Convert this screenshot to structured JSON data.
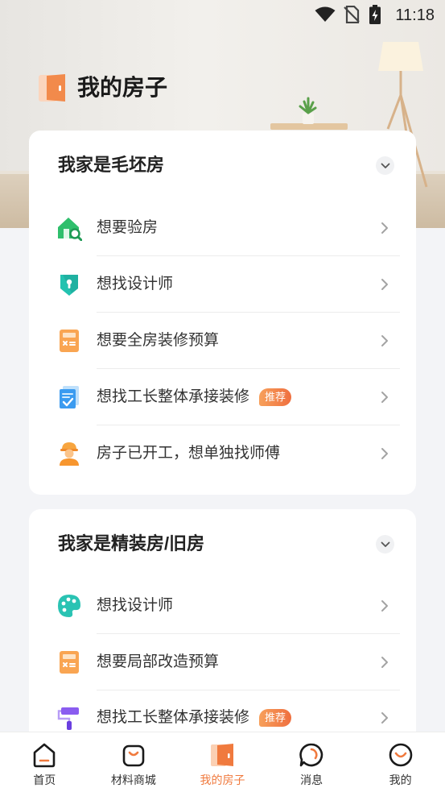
{
  "status_bar": {
    "time": "11:18",
    "icons": [
      "wifi-icon",
      "no-sim-icon",
      "battery-charging-icon"
    ]
  },
  "page": {
    "title": "我的房子",
    "title_icon": "door-icon"
  },
  "sections": [
    {
      "title": "我家是毛坯房",
      "items": [
        {
          "label": "想要验房",
          "icon": "house-inspect-icon"
        },
        {
          "label": "想找设计师",
          "icon": "designer-badge-icon"
        },
        {
          "label": "想要全房装修预算",
          "icon": "calculator-icon"
        },
        {
          "label": "想找工长整体承接装修",
          "icon": "checklist-icon",
          "badge": "推荐"
        },
        {
          "label": "房子已开工，想单独找师傅",
          "icon": "worker-icon"
        }
      ]
    },
    {
      "title": "我家是精装房/旧房",
      "items": [
        {
          "label": "想找设计师",
          "icon": "palette-icon"
        },
        {
          "label": "想要局部改造预算",
          "icon": "calculator-icon"
        },
        {
          "label": "想找工长整体承接装修",
          "icon": "paint-roller-icon",
          "badge": "推荐"
        }
      ]
    }
  ],
  "tabbar": {
    "items": [
      {
        "label": "首页",
        "icon": "home-icon",
        "active": false
      },
      {
        "label": "材料商城",
        "icon": "shopping-bag-icon",
        "active": false
      },
      {
        "label": "我的房子",
        "icon": "door-icon",
        "active": true
      },
      {
        "label": "消息",
        "icon": "message-icon",
        "active": false
      },
      {
        "label": "我的",
        "icon": "profile-icon",
        "active": false
      }
    ]
  },
  "colors": {
    "accent": "#f07a3e",
    "badge_gradient_start": "#f7a05b",
    "badge_gradient_end": "#ef6f3f",
    "page_background": "#f3f4f7",
    "card_background": "#ffffff"
  }
}
